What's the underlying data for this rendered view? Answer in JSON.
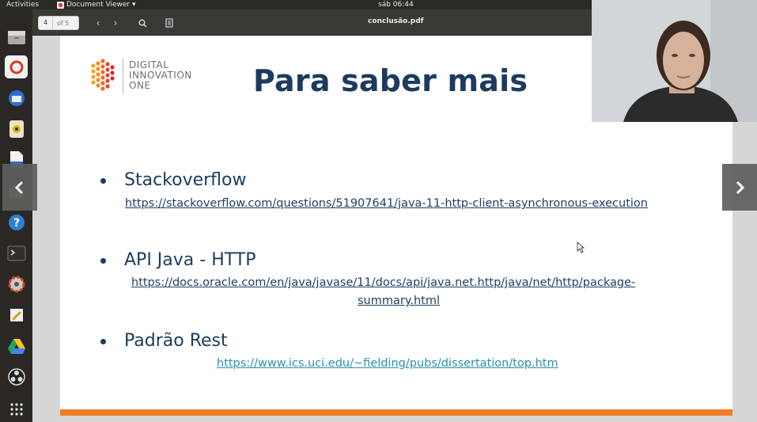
{
  "top_panel": {
    "activities": "Activities",
    "app_name": "Document Viewer ▾",
    "clock": "sáb 06:44"
  },
  "header_bar": {
    "page_current": "4",
    "page_total": "of 5",
    "document_title": "conclusão.pdf"
  },
  "slide": {
    "logo_text": [
      "DIGITAL",
      "INNOVATION",
      "ONE"
    ],
    "title": "Para saber mais",
    "items": [
      {
        "heading": "Stackoverflow",
        "links": [
          "https://stackoverflow.com/questions/51907641/java-11-http-client-asynchronous-execution"
        ]
      },
      {
        "heading": "API Java - HTTP",
        "links": [
          "https://docs.oracle.com/en/java/javase/11/docs/api/java.net.http/java/net/http/package-",
          "summary.html"
        ]
      },
      {
        "heading": "Padrão Rest",
        "links": [
          "https://www.ics.uci.edu/~fielding/pubs/dissertation/top.htm"
        ]
      }
    ]
  },
  "nav": {
    "prev_icon": "chevron-left-icon",
    "next_icon": "chevron-right-icon"
  },
  "colors": {
    "title_blue": "#1d3b5f",
    "link_teal": "#2a8fb0",
    "footer_orange": "#f07f29"
  }
}
